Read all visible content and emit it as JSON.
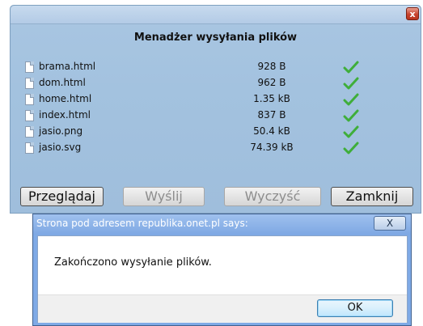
{
  "manager": {
    "title": "Menadżer wysyłania plików",
    "close_glyph": "x",
    "files": [
      {
        "name": "brama.html",
        "size": "928 B"
      },
      {
        "name": "dom.html",
        "size": "962 B"
      },
      {
        "name": "home.html",
        "size": "1.35 kB"
      },
      {
        "name": "index.html",
        "size": "837 B"
      },
      {
        "name": "jasio.png",
        "size": "50.4 kB"
      },
      {
        "name": "jasio.svg",
        "size": "74.39 kB"
      }
    ],
    "file_icon": "file-icon",
    "status_icon": "checkmark-icon",
    "status_color": "#3fae3a",
    "buttons": {
      "browse": "Przeglądaj",
      "send": "Wyślij",
      "clear": "Wyczyść",
      "close": "Zamknij"
    }
  },
  "alert": {
    "title": "Strona pod adresem republika.onet.pl says:",
    "close_glyph": "X",
    "message": "Zakończono wysyłanie plików.",
    "ok": "OK"
  }
}
